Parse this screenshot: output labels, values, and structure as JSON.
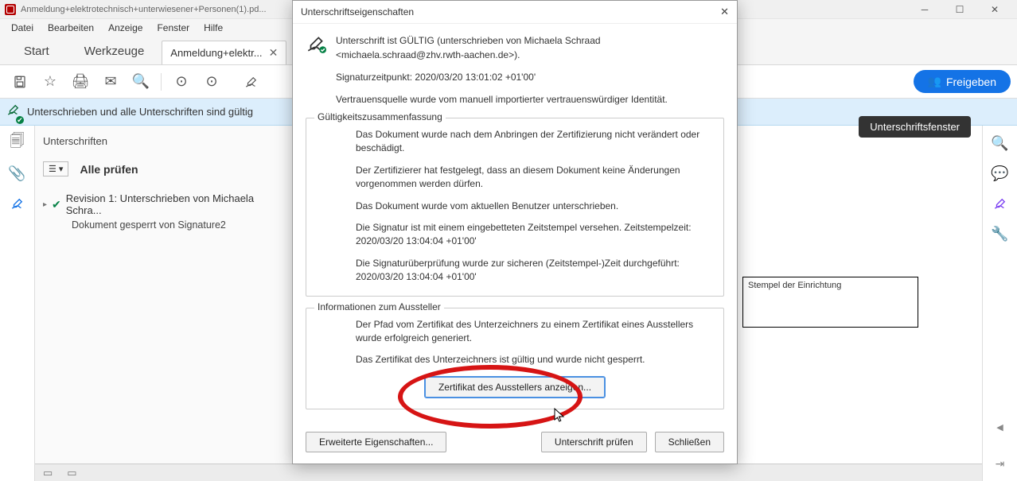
{
  "titlebar": {
    "text": "Anmeldung+elektrotechnisch+unterwiesener+Personen(1).pd..."
  },
  "menu": {
    "file": "Datei",
    "edit": "Bearbeiten",
    "view": "Anzeige",
    "window": "Fenster",
    "help": "Hilfe"
  },
  "tabs": {
    "start": "Start",
    "tools": "Werkzeuge",
    "doc": "Anmeldung+elektr..."
  },
  "toolbar": {
    "share": "Freigeben"
  },
  "sigbar": {
    "text": "Unterschrieben und alle Unterschriften sind gültig",
    "chip": "Unterschriftsfenster"
  },
  "sigpanel": {
    "title": "Unterschriften",
    "allcheck": "Alle prüfen",
    "rev1": "Revision 1: Unterschrieben von Michaela Schra...",
    "locked": "Dokument gesperrt von Signature2"
  },
  "stamp": {
    "label": "Stempel der Einrichtung"
  },
  "dialog": {
    "title": "Unterschriftseigenschaften",
    "top_line1": "Unterschrift ist GÜLTIG (unterschrieben von Michaela Schraad <michaela.schraad@zhv.rwth-aachen.de>).",
    "top_line2": "Signaturzeitpunkt: 2020/03/20 13:01:02 +01'00'",
    "top_line3": "Vertrauensquelle wurde vom manuell importierter vertrauenswürdiger Identität.",
    "group1_legend": "Gültigkeitszusammenfassung",
    "g1_1": "Das Dokument wurde nach dem Anbringen der Zertifizierung nicht verändert oder beschädigt.",
    "g1_2": "Der Zertifizierer hat festgelegt, dass an diesem Dokument keine Änderungen vorgenommen werden dürfen.",
    "g1_3": "Das Dokument wurde vom aktuellen Benutzer unterschrieben.",
    "g1_4": "Die Signatur ist mit einem eingebetteten Zeitstempel versehen. Zeitstempelzeit: 2020/03/20 13:04:04 +01'00'",
    "g1_5": "Die Signaturüberprüfung wurde zur sicheren (Zeitstempel-)Zeit durchgeführt: 2020/03/20 13:04:04 +01'00'",
    "group2_legend": "Informationen zum Aussteller",
    "g2_1": "Der Pfad vom Zertifikat des Unterzeichners zu einem Zertifikat eines Ausstellers wurde erfolgreich generiert.",
    "g2_2": "Das Zertifikat des Unterzeichners ist gültig und wurde nicht gesperrt.",
    "cert_btn": "Zertifikat des Ausstellers anzeigen...",
    "advanced_btn": "Erweiterte Eigenschaften...",
    "check_btn": "Unterschrift prüfen",
    "close_btn": "Schließen"
  }
}
